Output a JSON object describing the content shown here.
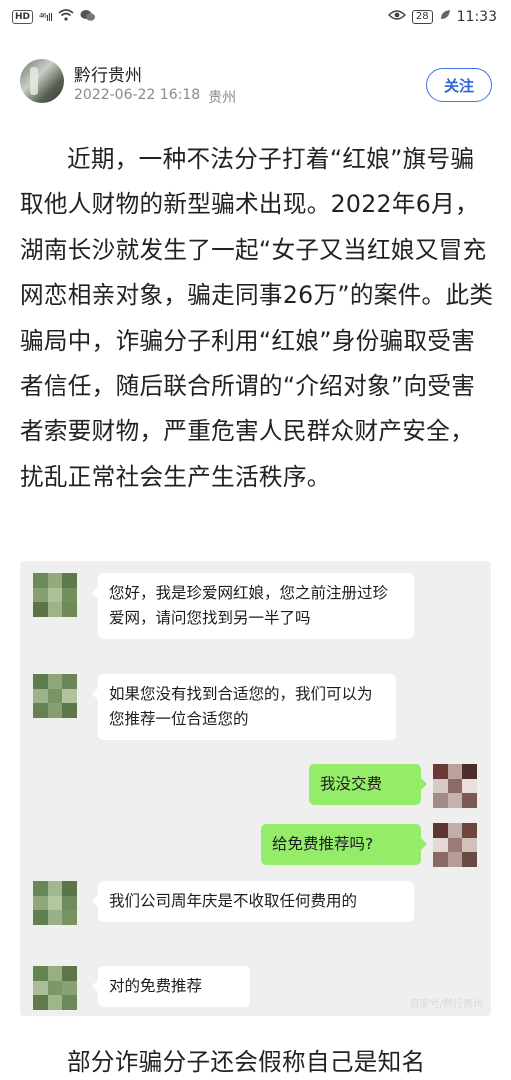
{
  "status_bar": {
    "hd": "HD",
    "signal": "⁴⁶ıll",
    "battery": "28",
    "time": "11:33"
  },
  "post": {
    "author": "黔行贵州",
    "datetime": "2022-06-22 16:18",
    "location": "贵州",
    "follow_label": "关注"
  },
  "article": {
    "paragraph": "近期，一种不法分子打着“红娘”旗号骗取他人财物的新型骗术出现。2022年6月，湖南长沙就发生了一起“女子又当红娘又冒充网恋相亲对象，骗走同事26万”的案件。此类骗局中，诈骗分子利用“红娘”身份骗取受害者信任，随后联合所谓的“介绍对象”向受害者索要财物，严重危害人民群众财产安全，扰乱正常社会生产生活秩序。",
    "next_paragraph": "部分诈骗分子还会假称自己是知名"
  },
  "chat": {
    "messages": [
      {
        "side": "in",
        "text": "您好，我是珍爱网红娘，您之前注册过珍爱网，请问您找到另一半了吗"
      },
      {
        "side": "in",
        "text": "如果您没有找到合适您的，我们可以为您推荐一位合适您的"
      },
      {
        "side": "out",
        "text": "我没交费"
      },
      {
        "side": "out",
        "text": "给免费推荐吗?"
      },
      {
        "side": "in",
        "text": "我们公司周年庆是不收取任何费用的"
      },
      {
        "side": "in",
        "text": "对的免费推荐"
      }
    ],
    "watermark": "百家号/黔行贵州"
  }
}
